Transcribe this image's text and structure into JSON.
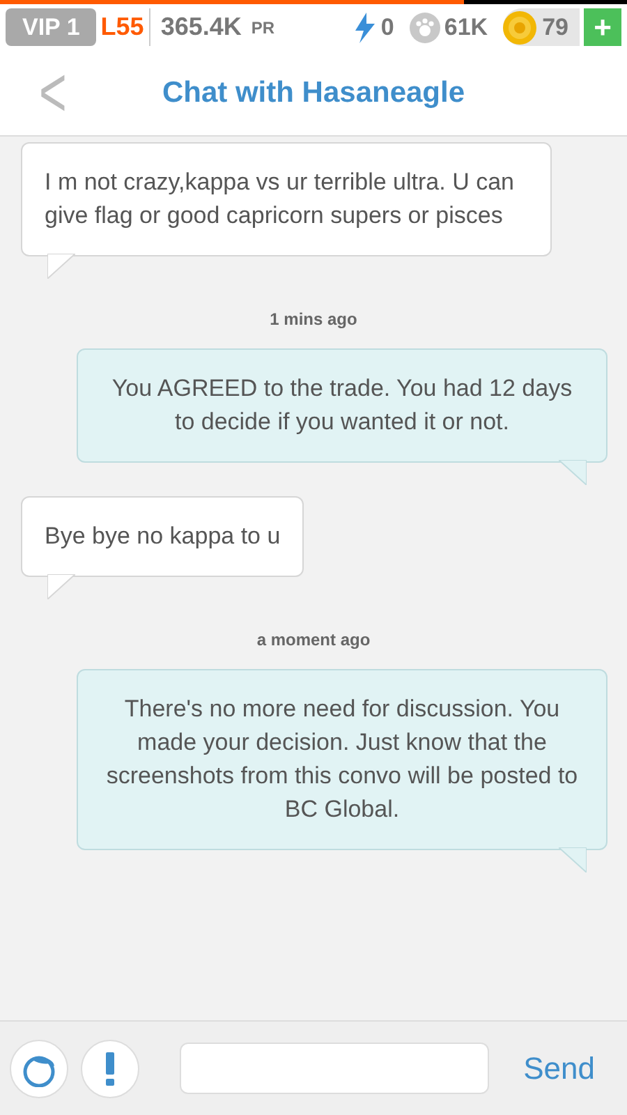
{
  "status_bar": {
    "vip": "VIP 1",
    "level_label": "L55",
    "pr": "365.4K",
    "pr_unit": "PR",
    "energy": "0",
    "paws": "61K",
    "coins": "79",
    "plus": "+",
    "progress": {
      "level": 0.74
    }
  },
  "header": {
    "back": "<",
    "title": "Chat with Hasaneagle"
  },
  "messages": [
    {
      "kind": "incoming",
      "text": "I m not crazy,kappa vs ur terrible ultra. U can give flag or good capricorn supers or pisces"
    },
    {
      "kind": "time",
      "text": "1 mins ago"
    },
    {
      "kind": "outgoing",
      "text": "You AGREED to the trade. You had 12 days to decide if you wanted it or not."
    },
    {
      "kind": "incoming",
      "text": "Bye bye no kappa to u"
    },
    {
      "kind": "time",
      "text": "a moment ago"
    },
    {
      "kind": "outgoing",
      "text": "There's no more need for discussion. You made your decision. Just know that the screenshots from this convo will be posted to BC Global."
    }
  ],
  "composer": {
    "send": "Send"
  }
}
